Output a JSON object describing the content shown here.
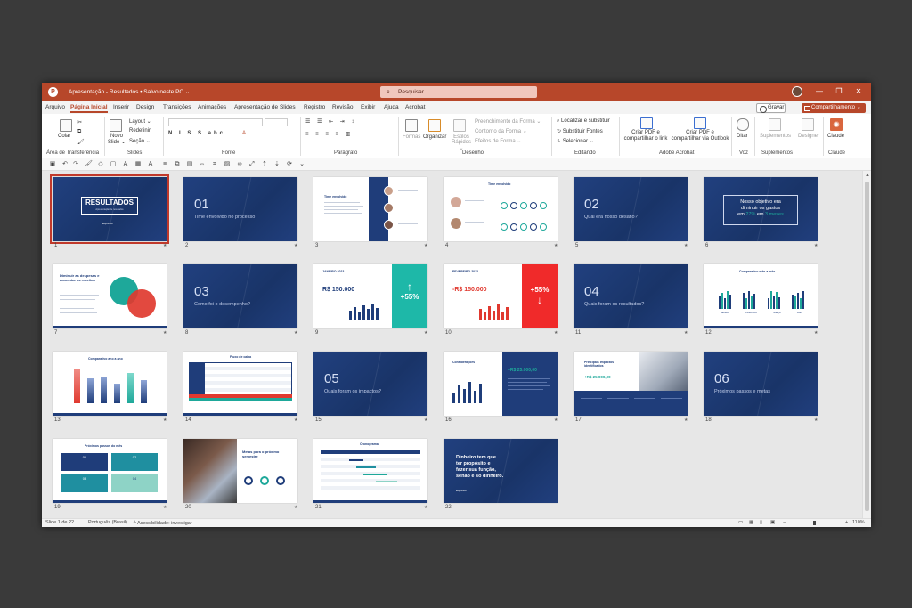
{
  "titlebar": {
    "app_icon": "P",
    "doc_title": "Apresentação - Resultados • Salvo neste PC ⌄",
    "search_placeholder": "Pesquisar",
    "minimize": "—",
    "restore": "❐",
    "close": "✕"
  },
  "tabs": [
    "Arquivo",
    "Página Inicial",
    "Inserir",
    "Design",
    "Transições",
    "Animações",
    "Apresentação de Slides",
    "Registro",
    "Revisão",
    "Exibir",
    "Ajuda",
    "Acrobat"
  ],
  "actions": {
    "record": "Gravar",
    "share": "Compartilhamento ⌄"
  },
  "ribbon": {
    "clipboard": {
      "paste": "Colar",
      "label": "Área de Transferência"
    },
    "slides": {
      "new_slide": "Novo Slide ⌄",
      "layout": "Layout ⌄",
      "reset": "Redefinir",
      "section": "Seção ⌄",
      "label": "Slides"
    },
    "font": {
      "label": "Fonte"
    },
    "paragraph": {
      "label": "Parágrafo"
    },
    "drawing": {
      "shapes": "Formas",
      "arrange": "Organizar",
      "quick_styles": "Estilos Rápidos ⌄",
      "fill": "Preenchimento da Forma ⌄",
      "outline": "Contorno da Forma ⌄",
      "effects": "Efeitos de Forma ⌄",
      "label": "Desenho"
    },
    "editing": {
      "find": "Localizar e substituir",
      "replace_fonts": "Substituir Fontes",
      "select": "Selecionar ⌄",
      "label": "Editando"
    },
    "acrobat": {
      "pdf_link": "Criar PDF e compartilhar o link",
      "pdf_outlook": "Criar PDF e compartilhar via Outlook",
      "label": "Adobe Acrobat"
    },
    "voice": {
      "dictate": "Ditar",
      "label": "Voz"
    },
    "addins": {
      "addins": "Suplementos",
      "designer": "Designer",
      "label": "Suplementos"
    },
    "claude": {
      "claude": "Claude",
      "label": "Claude"
    }
  },
  "slides": [
    {
      "num": "1",
      "title": "RESULTADOS",
      "sub": "Apresentação de resultados",
      "brand": "Expressi"
    },
    {
      "num": "2",
      "big": "01",
      "text": "Time envolvido no processo"
    },
    {
      "num": "3",
      "title": "Time envolvido"
    },
    {
      "num": "4",
      "title": "Time envolvido"
    },
    {
      "num": "5",
      "big": "02",
      "text": "Qual era nosso desafio?"
    },
    {
      "num": "6",
      "quote_a": "Nosso objetivo era",
      "quote_b": "diminuir os gastos",
      "quote_c_pre": "em ",
      "quote_c_hl1": "27%",
      "quote_c_mid": " em ",
      "quote_c_hl2": "3 meses"
    },
    {
      "num": "7",
      "title": "Diminuir as despesas e aumentar as receitas"
    },
    {
      "num": "8",
      "big": "03",
      "text": "Como foi o desempenho?"
    },
    {
      "num": "9",
      "month": "JANEIRO 2023",
      "value": "R$ 150.000",
      "pct": "+55%",
      "arrow": "↑"
    },
    {
      "num": "10",
      "month": "FEVEREIRO 2023",
      "value": "-R$ 150.000",
      "pct": "+55%",
      "arrow": "↓"
    },
    {
      "num": "11",
      "big": "04",
      "text": "Quais foram os resultados?"
    },
    {
      "num": "12",
      "title": "Comparativo mês a mês",
      "labels": [
        "Janeiro",
        "Fevereiro",
        "Março",
        "Abril"
      ]
    },
    {
      "num": "13",
      "title": "Comparativo ano a ano"
    },
    {
      "num": "14",
      "title": "Fluxo de caixa"
    },
    {
      "num": "15",
      "big": "05",
      "text": "Quais foram os impactos?"
    },
    {
      "num": "16",
      "title": "Considerações",
      "value": "+R$ 25.000,00"
    },
    {
      "num": "17",
      "title": "Principais impactos identificados",
      "value": "+R$ 25.000,00"
    },
    {
      "num": "18",
      "big": "06",
      "text": "Próximos passos e metas"
    },
    {
      "num": "19",
      "title": "Próximos passos do mês",
      "boxes": [
        "01",
        "02",
        "03",
        "04"
      ]
    },
    {
      "num": "20",
      "title": "Metas para o próximo semestre"
    },
    {
      "num": "21",
      "title": "Cronograma"
    },
    {
      "num": "22",
      "quote_a": "Dinheiro tem que",
      "quote_b": "ter propósito e",
      "quote_c": "fazer sua função,",
      "quote_d": "senão é só dinheiro.",
      "brand": "Expressi"
    }
  ],
  "statusbar": {
    "slide_count": "Slide 1 de 22",
    "language": "Português (Brasil)",
    "accessibility": "Acessibilidade: investigar",
    "zoom": "110%"
  }
}
